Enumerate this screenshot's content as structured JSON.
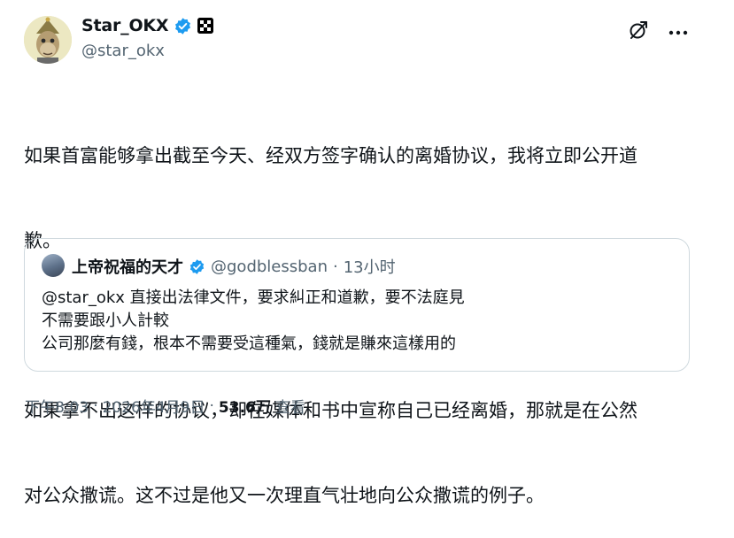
{
  "author": {
    "display_name": "Star_OKX",
    "handle": "@star_okx"
  },
  "tweet": {
    "line1": "如果首富能够拿出截至今天、经双方签字确认的离婚协议，我将立即公开道",
    "line2": "歉。",
    "line3": "如果拿不出这样的协议，却在媒体和书中宣称自己已经离婚，那就是在公然",
    "line4": "对公众撒谎。这不过是他又一次理直气壮地向公众撒谎的例子。"
  },
  "quote": {
    "display_name": "上帝祝福的天才",
    "handle": "@godblessban",
    "dot": "·",
    "time": "13小时",
    "lines": [
      "@star_okx 直接出法律文件，要求糾正和道歉，要不法庭見",
      "不需要跟小人計較",
      "公司那麼有錢，根本不需要受這種氣，錢就是賺來這樣用的"
    ]
  },
  "meta": {
    "time": "下午8:03",
    "sep1": "·",
    "date": "2026年4月9日",
    "sep2": "·",
    "views": "53.6万",
    "views_label": "查看"
  },
  "icons": {
    "verified": "verified-badge-icon",
    "affiliate": "okx-affiliate-icon",
    "grok": "grok-icon",
    "more": "more-options-icon"
  },
  "colors": {
    "verified_blue": "#1d9bf0",
    "secondary_text": "#536471",
    "border": "#cfd9de"
  }
}
